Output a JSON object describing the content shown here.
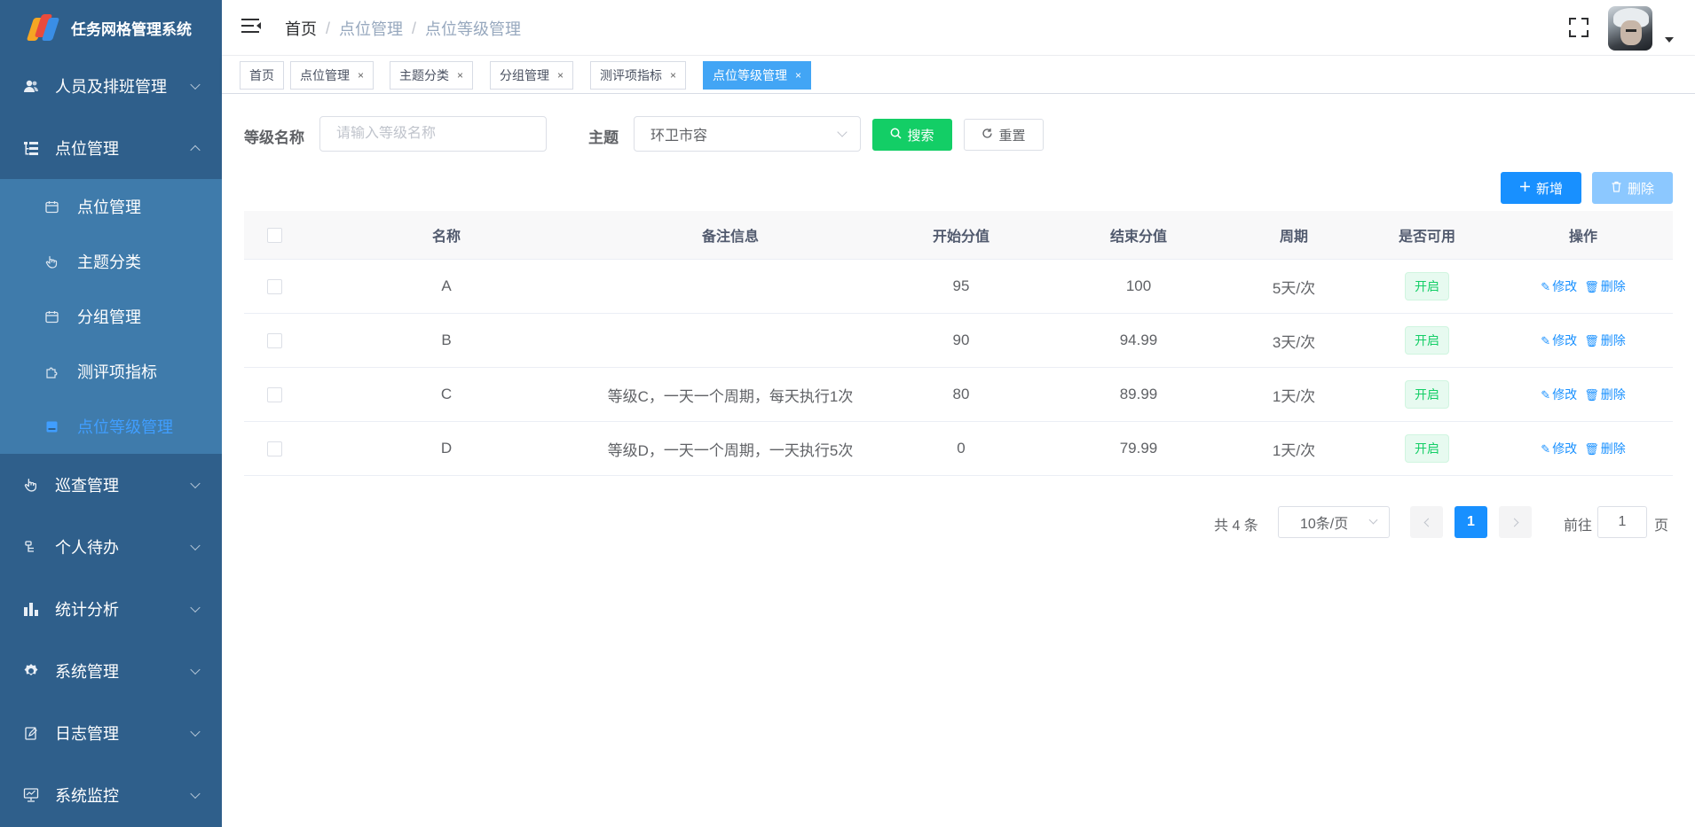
{
  "app": {
    "title": "任务网格管理系统"
  },
  "sidebar": {
    "items": [
      {
        "label": "人员及排班管理",
        "icon": "user-icon"
      },
      {
        "label": "点位管理",
        "icon": "tree-icon",
        "expanded": true,
        "children": [
          {
            "label": "点位管理",
            "icon": "calendar-icon"
          },
          {
            "label": "主题分类",
            "icon": "hand-icon"
          },
          {
            "label": "分组管理",
            "icon": "calendar-icon"
          },
          {
            "label": "测评项指标",
            "icon": "puzzle-icon"
          },
          {
            "label": "点位等级管理",
            "icon": "level-icon",
            "active": true
          }
        ]
      },
      {
        "label": "巡查管理",
        "icon": "hand-icon"
      },
      {
        "label": "个人待办",
        "icon": "todo-icon"
      },
      {
        "label": "统计分析",
        "icon": "chart-icon"
      },
      {
        "label": "系统管理",
        "icon": "gear-icon"
      },
      {
        "label": "日志管理",
        "icon": "edit-icon"
      },
      {
        "label": "系统监控",
        "icon": "monitor-icon"
      }
    ]
  },
  "header": {
    "breadcrumb": [
      "首页",
      "点位管理",
      "点位等级管理"
    ],
    "breadcrumb_sep": "/"
  },
  "tags": [
    {
      "label": "首页",
      "closable": false
    },
    {
      "label": "点位管理",
      "closable": true
    },
    {
      "label": "主题分类",
      "closable": true
    },
    {
      "label": "分组管理",
      "closable": true
    },
    {
      "label": "测评项指标",
      "closable": true
    },
    {
      "label": "点位等级管理",
      "closable": true,
      "active": true
    }
  ],
  "search": {
    "name_label": "等级名称",
    "name_placeholder": "请输入等级名称",
    "name_value": "",
    "theme_label": "主题",
    "theme_value": "环卫市容",
    "search_btn": "搜索",
    "reset_btn": "重置"
  },
  "toolbar": {
    "add_label": "新增",
    "delete_label": "删除"
  },
  "table": {
    "columns": [
      "名称",
      "备注信息",
      "开始分值",
      "结束分值",
      "周期",
      "是否可用",
      "操作"
    ],
    "rows": [
      {
        "name": "A",
        "remark": "",
        "start": "95",
        "end": "100",
        "cycle": "5天/次",
        "status": "开启"
      },
      {
        "name": "B",
        "remark": "",
        "start": "90",
        "end": "94.99",
        "cycle": "3天/次",
        "status": "开启"
      },
      {
        "name": "C",
        "remark": "等级C，一天一个周期，每天执行1次",
        "start": "80",
        "end": "89.99",
        "cycle": "1天/次",
        "status": "开启"
      },
      {
        "name": "D",
        "remark": "等级D，一天一个周期，一天执行5次",
        "start": "0",
        "end": "79.99",
        "cycle": "1天/次",
        "status": "开启"
      }
    ],
    "edit_label": "修改",
    "delete_label": "删除"
  },
  "pagination": {
    "total_text": "共 4 条",
    "page_size": "10条/页",
    "current": "1",
    "goto_label": "前往",
    "goto_value": "1",
    "page_suffix": "页"
  },
  "colors": {
    "sidebar_bg": "#2f5f8b",
    "submenu_bg": "#3f7bab",
    "primary": "#1890ff",
    "success": "#13ce66"
  }
}
